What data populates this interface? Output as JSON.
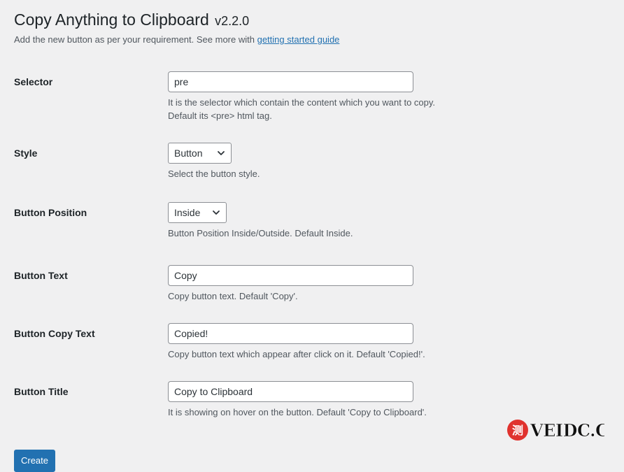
{
  "header": {
    "title": "Copy Anything to Clipboard",
    "version": "v2.2.0",
    "subtitle_text": "Add the new button as per your requirement. See more with",
    "subtitle_link": "getting started guide"
  },
  "form": {
    "selector": {
      "label": "Selector",
      "value": "pre",
      "desc_line1": "It is the selector which contain the content which you want to copy.",
      "desc_line2": "Default its <pre> html tag."
    },
    "style": {
      "label": "Style",
      "value": "Button",
      "desc": "Select the button style."
    },
    "button_position": {
      "label": "Button Position",
      "value": "Inside",
      "desc": "Button Position Inside/Outside. Default Inside."
    },
    "button_text": {
      "label": "Button Text",
      "value": "Copy",
      "desc": "Copy button text. Default 'Copy'."
    },
    "button_copy_text": {
      "label": "Button Copy Text",
      "value": "Copied!",
      "desc": "Copy button text which appear after click on it. Default 'Copied!'."
    },
    "button_title": {
      "label": "Button Title",
      "value": "Copy to Clipboard",
      "desc": "It is showing on hover on the button. Default 'Copy to Clipboard'."
    }
  },
  "actions": {
    "create_label": "Create"
  },
  "watermark": {
    "text": "VEIDC.COM",
    "badge": "测"
  },
  "colors": {
    "background": "#f0f0f1",
    "link": "#2271b1",
    "primary_button": "#2271b1",
    "watermark_badge": "#e0322e"
  }
}
